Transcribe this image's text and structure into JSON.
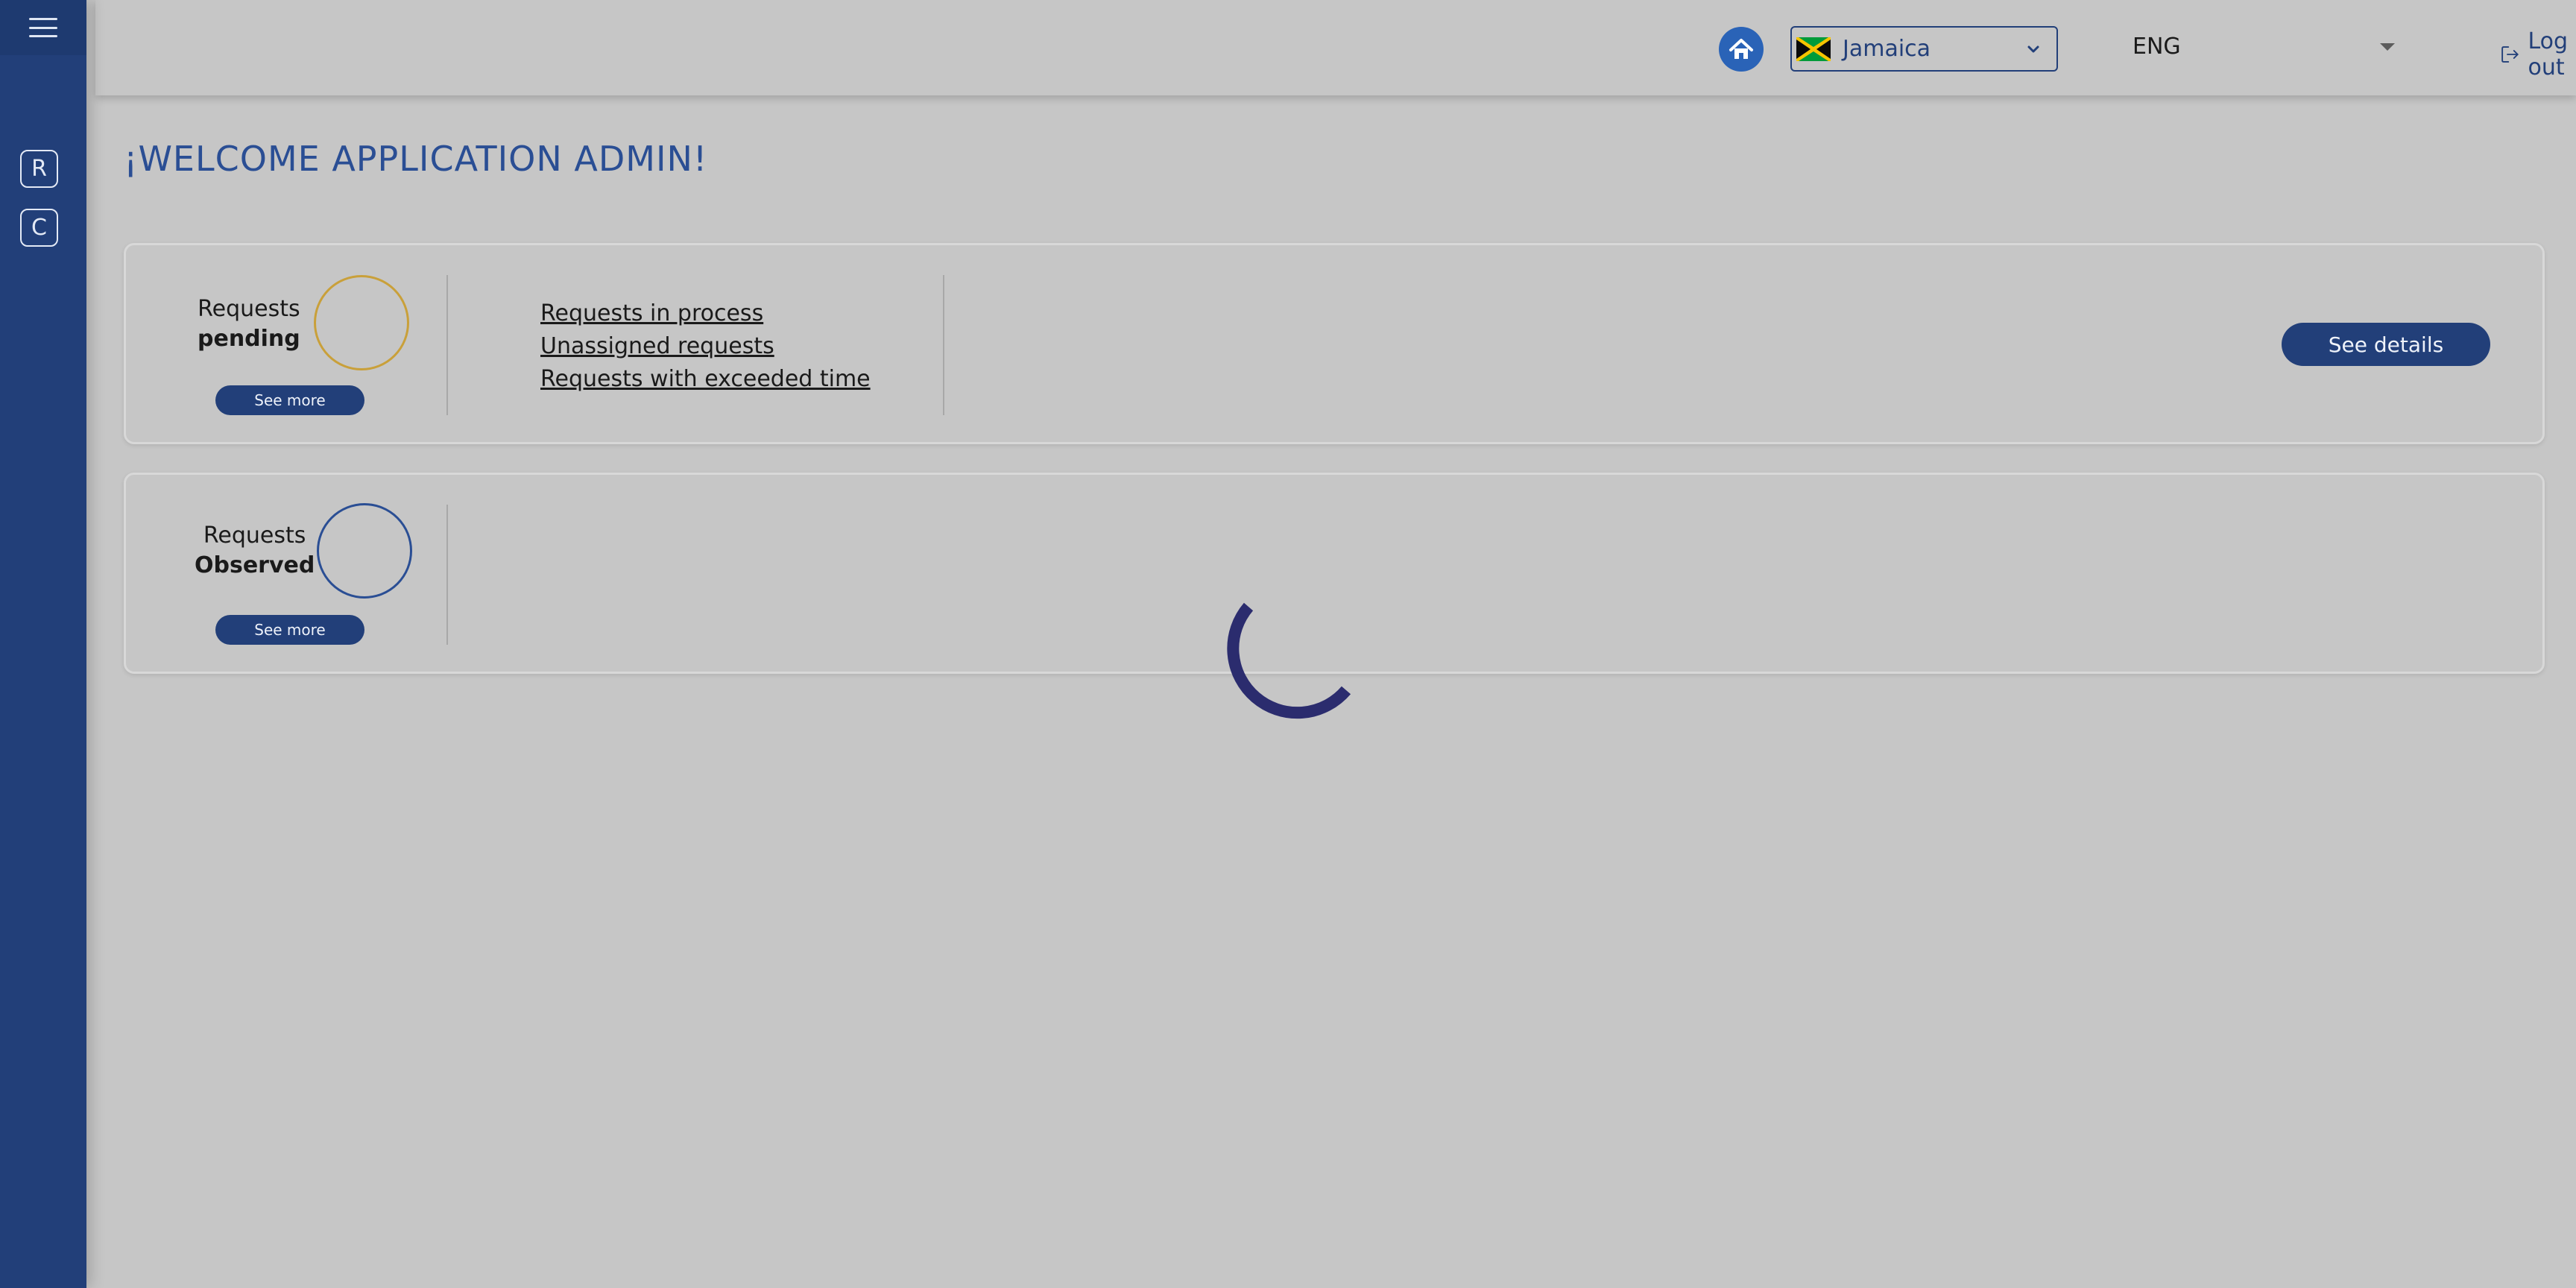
{
  "colors": {
    "sidebar": "#223f79",
    "accent": "#2a4e94",
    "home_button": "#2a63b7",
    "pending_ring": "#c9a03a",
    "observed_ring": "#2a4e94",
    "spinner": "#2b2c6e",
    "background": "#c6c6c6"
  },
  "sidebar": {
    "menu_icon": "hamburger-icon",
    "items": [
      {
        "label": "R"
      },
      {
        "label": "C"
      }
    ]
  },
  "header": {
    "home_icon": "home-icon",
    "country": {
      "flag": "jamaica-flag",
      "name": "Jamaica"
    },
    "language": "ENG",
    "logout_label": "Log out"
  },
  "main": {
    "title": "¡WELCOME APPLICATION ADMIN!",
    "pending_card": {
      "label_line1": "Requests",
      "label_line2": "pending",
      "see_more": "See more",
      "links": [
        "Requests in process",
        "Unassigned requests",
        "Requests with exceeded time"
      ],
      "details_button": "See details"
    },
    "observed_card": {
      "label_line1": "Requests",
      "label_line2": "Observed",
      "see_more": "See more"
    }
  },
  "loading": {
    "state": "loading",
    "icon": "spinner-icon"
  }
}
